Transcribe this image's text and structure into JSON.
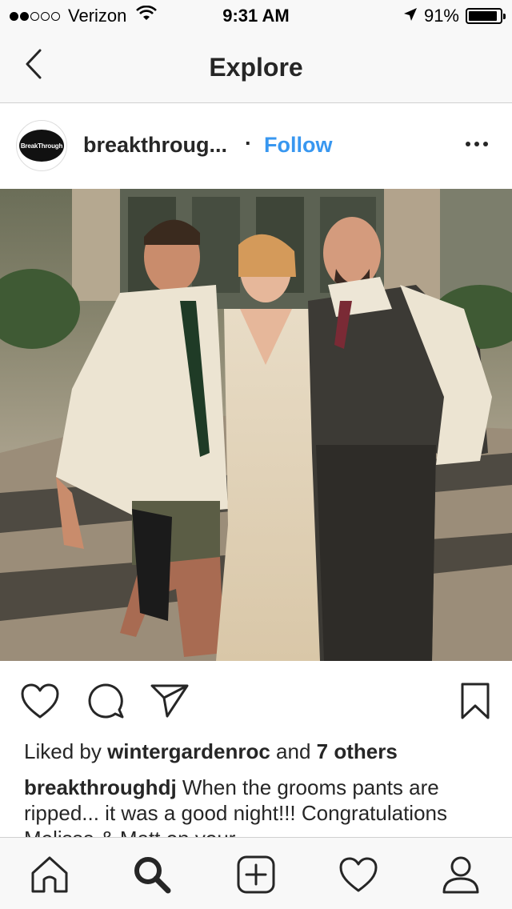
{
  "status_bar": {
    "carrier": "Verizon",
    "signal_bars_filled": 2,
    "signal_bars_total": 5,
    "time": "9:31 AM",
    "battery": "91%",
    "battery_level": 0.91
  },
  "nav": {
    "title": "Explore"
  },
  "post": {
    "username": "breakthroug...",
    "separator": "·",
    "follow_label": "Follow",
    "avatar_text": "BreakThrough",
    "likes": {
      "prefix": "Liked by",
      "user": "wintergardenroc",
      "middle": "and",
      "others": "7 others"
    },
    "caption": {
      "author": "breakthroughdj",
      "text": " When the grooms pants are ripped... it was a good night!!! Congratulations Melissa & Matt on your"
    }
  },
  "colors": {
    "accent": "#3897f0",
    "text": "#262626",
    "bar_bg": "#f8f8f8"
  },
  "icons": {
    "back": "chevron-left-icon",
    "more": "more-icon",
    "like": "heart-icon",
    "comment": "comment-icon",
    "share": "send-icon",
    "save": "bookmark-icon",
    "tabs": [
      "home-icon",
      "search-icon",
      "add-icon",
      "activity-icon",
      "profile-icon"
    ]
  }
}
